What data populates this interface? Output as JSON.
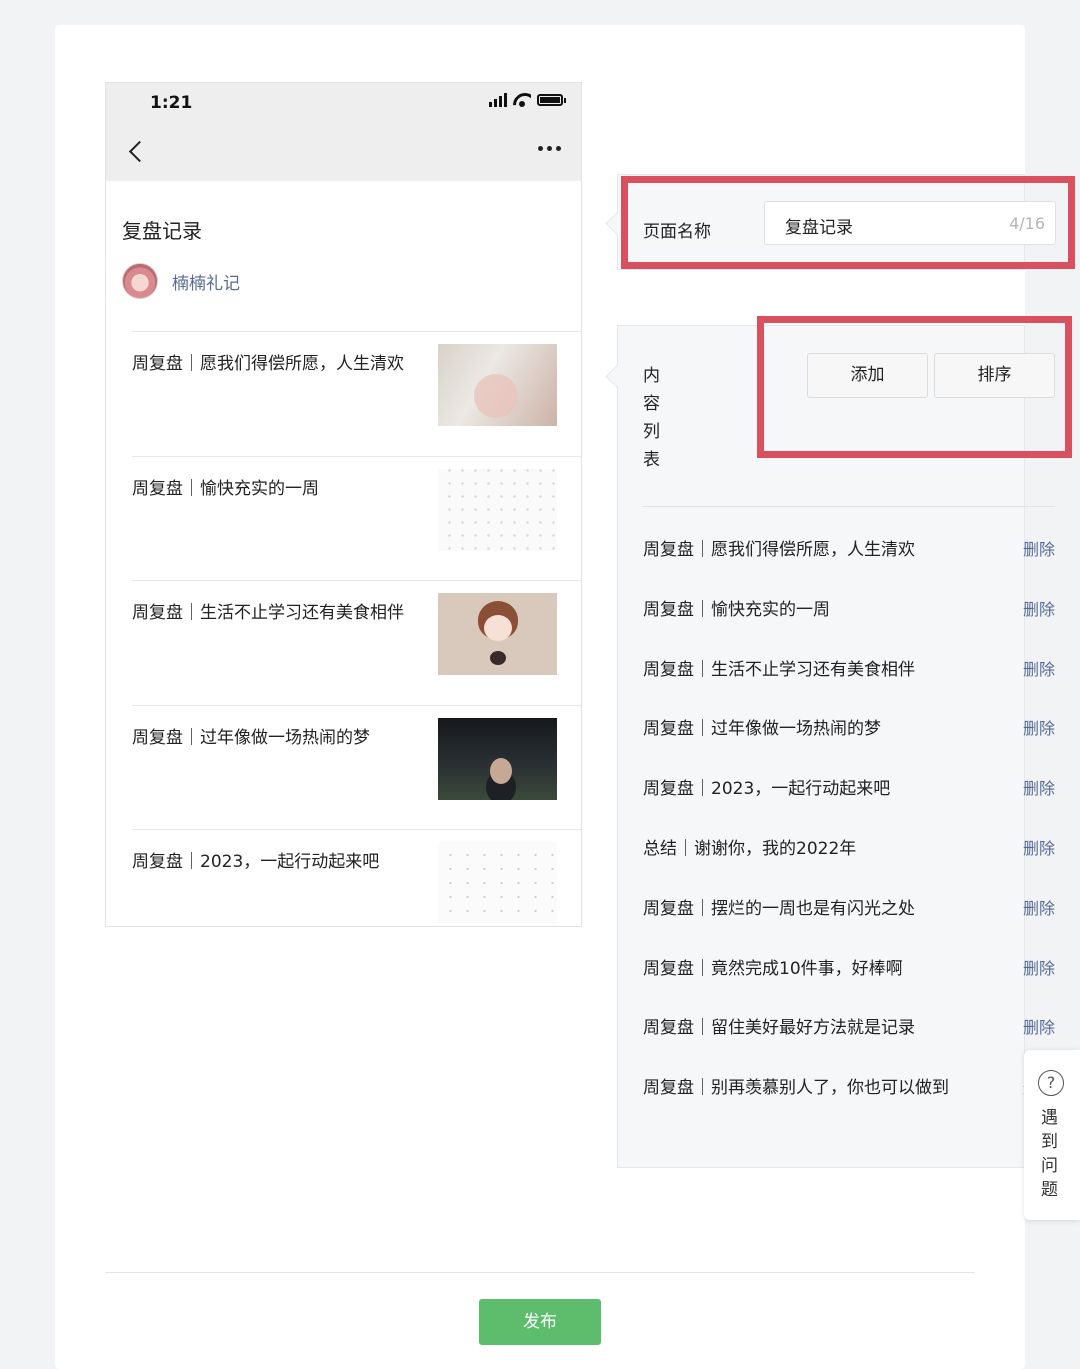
{
  "phone": {
    "time": "1:21",
    "page_title": "复盘记录",
    "author": "楠楠礼记",
    "articles": [
      {
        "title": "周复盘｜愿我们得偿所愿，人生清欢"
      },
      {
        "title": "周复盘｜愉快充实的一周"
      },
      {
        "title": "周复盘｜生活不止学习还有美食相伴"
      },
      {
        "title": "周复盘｜过年像做一场热闹的梦"
      },
      {
        "title": "周复盘｜2023，一起行动起来吧"
      }
    ]
  },
  "editor": {
    "page_name_label": "页面名称",
    "page_name_value": "复盘记录",
    "page_name_count": "4/16",
    "content_list_label": "内容列表",
    "add_label": "添加",
    "sort_label": "排序",
    "delete_label": "删除",
    "items": [
      {
        "title": "周复盘｜愿我们得偿所愿，人生清欢"
      },
      {
        "title": "周复盘｜愉快充实的一周"
      },
      {
        "title": "周复盘｜生活不止学习还有美食相伴"
      },
      {
        "title": "周复盘｜过年像做一场热闹的梦"
      },
      {
        "title": "周复盘｜2023，一起行动起来吧"
      },
      {
        "title": "总结｜谢谢你，我的2022年"
      },
      {
        "title": "周复盘｜摆烂的一周也是有闪光之处"
      },
      {
        "title": "周复盘｜竟然完成10件事，好棒啊"
      },
      {
        "title": "周复盘｜留住美好最好方法就是记录"
      },
      {
        "title": "周复盘｜别再羡慕别人了，你也可以做到"
      }
    ]
  },
  "help": {
    "label": "遇到问题",
    "icon": "?"
  },
  "publish_label": "发布",
  "colors": {
    "highlight": "#d9505e",
    "link": "#576b95",
    "publish": "#5dbd6d"
  }
}
